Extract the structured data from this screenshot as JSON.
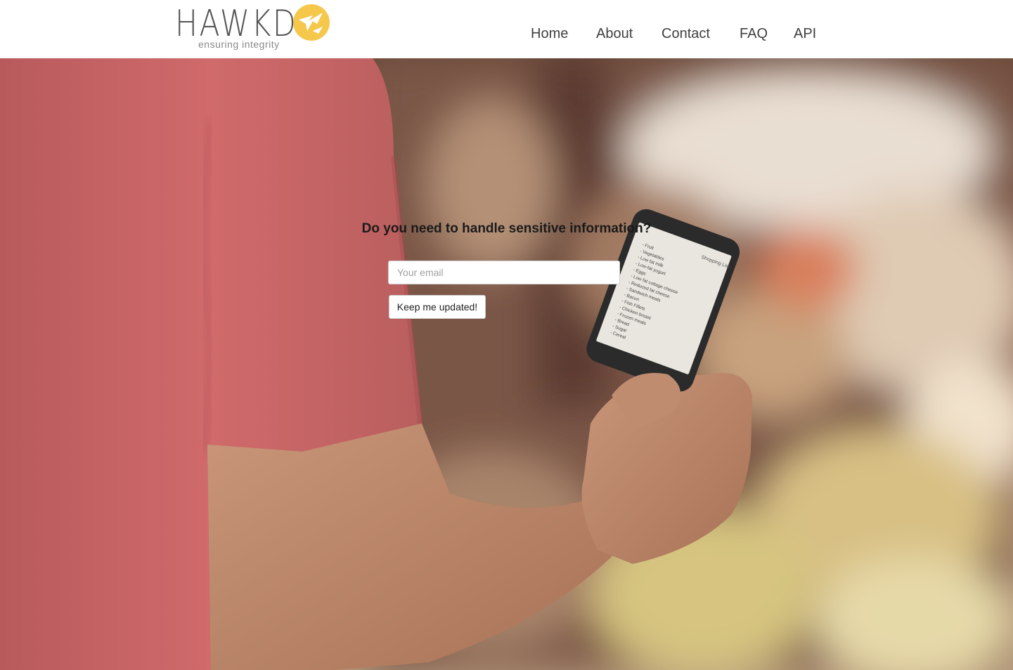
{
  "brand": {
    "name": "HAWKD",
    "tagline": "ensuring integrity",
    "accent_color": "#f5c84c",
    "text_color": "#555555"
  },
  "nav": {
    "items": [
      {
        "label": "Home"
      },
      {
        "label": "About"
      },
      {
        "label": "Contact"
      },
      {
        "label": "FAQ"
      },
      {
        "label": "API"
      }
    ]
  },
  "hero": {
    "headline": "Do you need to handle sensitive information?",
    "email": {
      "value": "",
      "placeholder": "Your email"
    },
    "submit_label": "Keep me updated!",
    "phone_screen": {
      "title": "Shopping List",
      "items": [
        "Fruit",
        "Vegetables",
        "Low fat milk",
        "Low-fat yogurt",
        "Eggs",
        "Low fat cottage cheese",
        "Reduced fat cheese",
        "Sandwich meats",
        "Bacon",
        "Fish Fillets",
        "Chicken breast",
        "Frozen meals",
        "Bread",
        "Sugar",
        "Cereal"
      ]
    }
  }
}
